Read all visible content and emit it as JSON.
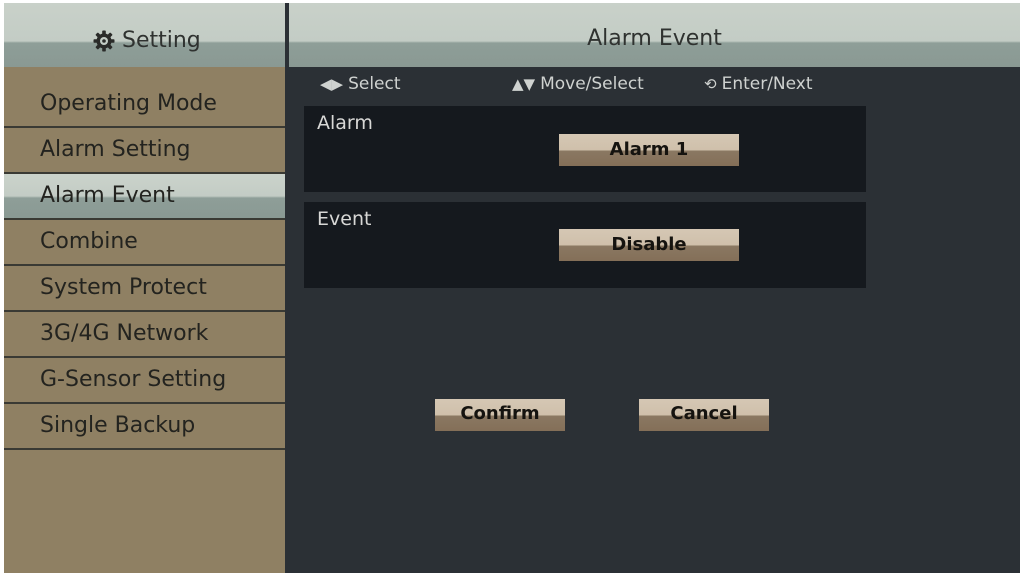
{
  "sidebar": {
    "title": "Setting",
    "title_icon": "gear-icon",
    "items": [
      {
        "label": "Operating Mode",
        "selected": false
      },
      {
        "label": "Alarm Setting",
        "selected": false
      },
      {
        "label": "Alarm Event",
        "selected": true
      },
      {
        "label": "Combine",
        "selected": false
      },
      {
        "label": "System Protect",
        "selected": false
      },
      {
        "label": "3G/4G Network",
        "selected": false
      },
      {
        "label": "G-Sensor Setting",
        "selected": false
      },
      {
        "label": "Single Backup",
        "selected": false
      }
    ]
  },
  "main": {
    "title": "Alarm Event",
    "hints": [
      {
        "icon": "left-right-arrows-icon",
        "label": "Select"
      },
      {
        "icon": "up-down-arrows-icon",
        "label": "Move/Select"
      },
      {
        "icon": "enter-next-icon",
        "label": "Enter/Next"
      }
    ],
    "alarm": {
      "label": "Alarm",
      "value": "Alarm 1"
    },
    "event": {
      "label": "Event",
      "value": "Disable"
    },
    "confirm_label": "Confirm",
    "cancel_label": "Cancel"
  },
  "colors": {
    "sidebar_bg": "#8f8063",
    "main_bg": "#2b3035",
    "panel_bg": "#15191e",
    "header_light": "#c3ccc5",
    "header_dark": "#8a9993",
    "button_light": "#cfc0ab",
    "button_dark": "#846f58"
  }
}
